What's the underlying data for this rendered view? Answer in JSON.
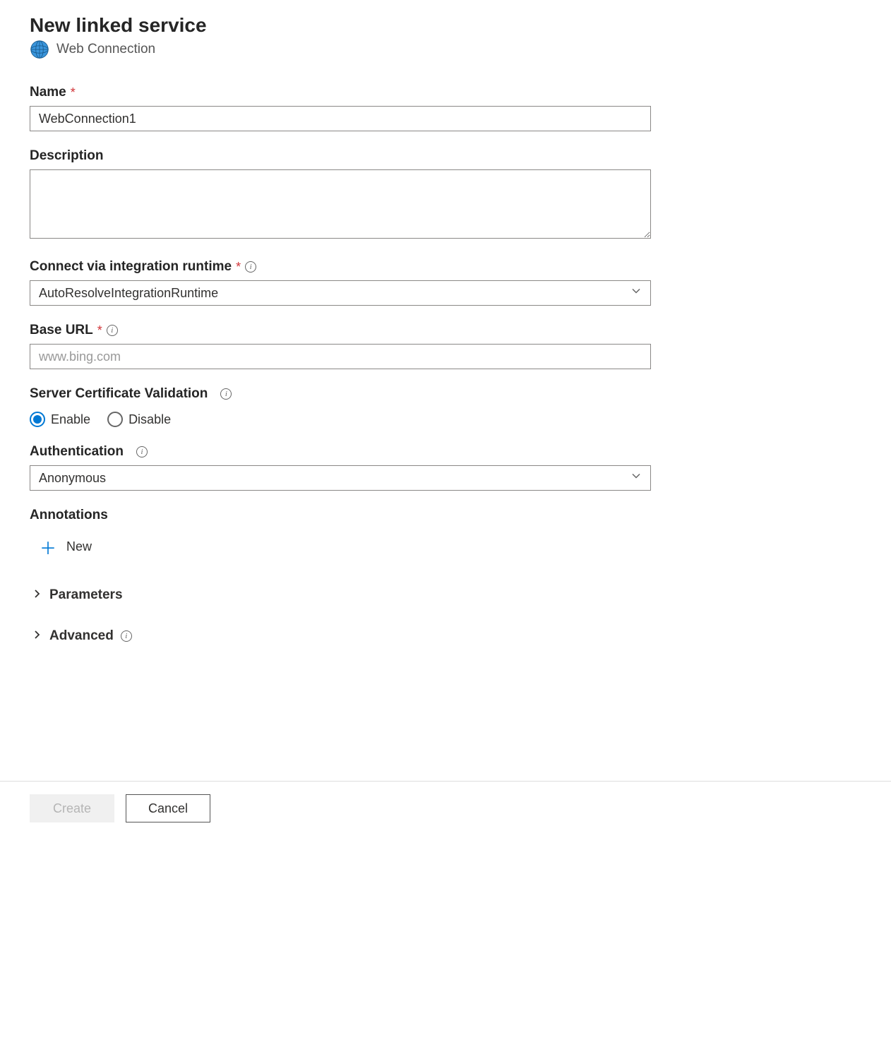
{
  "header": {
    "title": "New linked service",
    "subtitle": "Web Connection"
  },
  "fields": {
    "name": {
      "label": "Name",
      "value": "WebConnection1"
    },
    "description": {
      "label": "Description",
      "value": ""
    },
    "integration_runtime": {
      "label": "Connect via integration runtime",
      "value": "AutoResolveIntegrationRuntime"
    },
    "base_url": {
      "label": "Base URL",
      "value": "www.bing.com"
    },
    "server_cert": {
      "label": "Server Certificate Validation",
      "option_enable": "Enable",
      "option_disable": "Disable"
    },
    "authentication": {
      "label": "Authentication",
      "value": "Anonymous"
    },
    "annotations": {
      "label": "Annotations",
      "new_label": "New"
    }
  },
  "sections": {
    "parameters": "Parameters",
    "advanced": "Advanced"
  },
  "footer": {
    "create": "Create",
    "cancel": "Cancel"
  }
}
